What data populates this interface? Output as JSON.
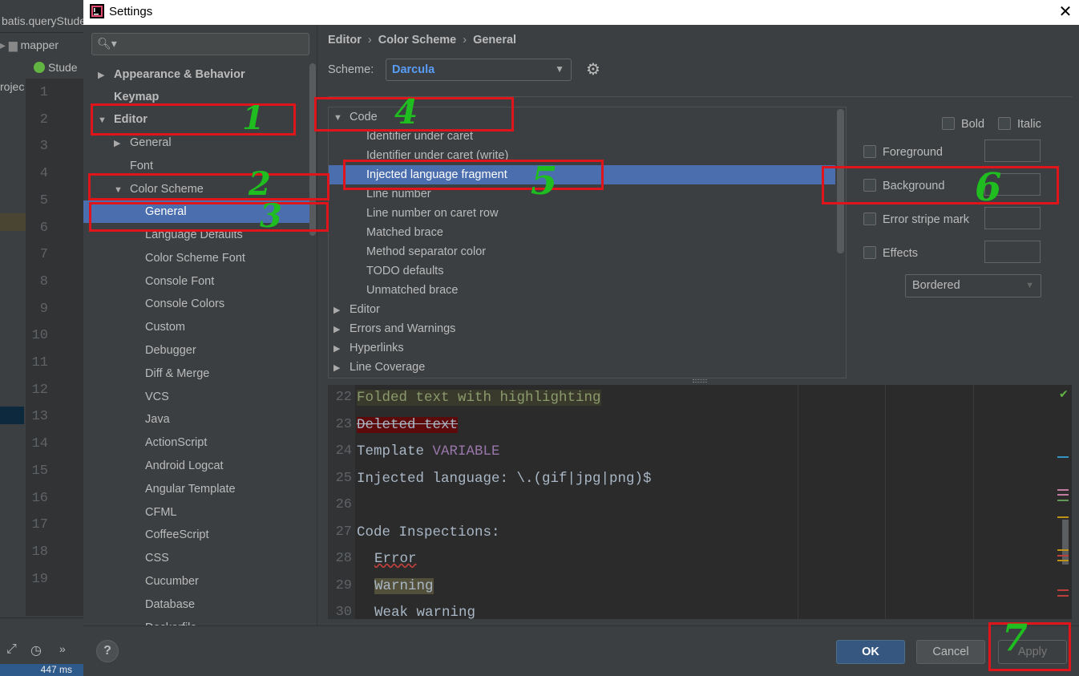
{
  "ide": {
    "tab_text": "batis.queryStude",
    "crumb_text": "mapper",
    "filetab_text": "Stude",
    "project_label": "rojec",
    "gutter_numbers": [
      "1",
      "2",
      "3",
      "4",
      "5",
      "6",
      "7",
      "8",
      "9",
      "10",
      "11",
      "12",
      "13",
      "14",
      "15",
      "16",
      "17",
      "18",
      "19"
    ],
    "perf_text": "447 ms"
  },
  "dialog": {
    "title": "Settings",
    "close_label": "✕"
  },
  "nav": {
    "search_placeholder": "",
    "items": [
      {
        "label": "Appearance & Behavior"
      },
      {
        "label": "Keymap"
      },
      {
        "label": "Editor"
      },
      {
        "label": "General"
      },
      {
        "label": "Font"
      },
      {
        "label": "Color Scheme"
      },
      {
        "label": "General"
      },
      {
        "label": "Language Defaults"
      },
      {
        "label": "Color Scheme Font"
      },
      {
        "label": "Console Font"
      },
      {
        "label": "Console Colors"
      },
      {
        "label": "Custom"
      },
      {
        "label": "Debugger"
      },
      {
        "label": "Diff & Merge"
      },
      {
        "label": "VCS"
      },
      {
        "label": "Java"
      },
      {
        "label": "ActionScript"
      },
      {
        "label": "Android Logcat"
      },
      {
        "label": "Angular Template"
      },
      {
        "label": "CFML"
      },
      {
        "label": "CoffeeScript"
      },
      {
        "label": "CSS"
      },
      {
        "label": "Cucumber"
      },
      {
        "label": "Database"
      },
      {
        "label": "Dockerfile"
      }
    ]
  },
  "header": {
    "breadcrumb": [
      "Editor",
      "Color Scheme",
      "General"
    ],
    "scheme_label": "Scheme:",
    "scheme_value": "Darcula"
  },
  "tree": {
    "rows": [
      {
        "label": "Code"
      },
      {
        "label": "Identifier under caret"
      },
      {
        "label": "Identifier under caret (write)"
      },
      {
        "label": "Injected language fragment"
      },
      {
        "label": "Line number"
      },
      {
        "label": "Line number on caret row"
      },
      {
        "label": "Matched brace"
      },
      {
        "label": "Method separator color"
      },
      {
        "label": "TODO defaults"
      },
      {
        "label": "Unmatched brace"
      },
      {
        "label": "Editor"
      },
      {
        "label": "Errors and Warnings"
      },
      {
        "label": "Hyperlinks"
      },
      {
        "label": "Line Coverage"
      }
    ]
  },
  "attributes": {
    "bold": "Bold",
    "italic": "Italic",
    "foreground": "Foreground",
    "background": "Background",
    "error_stripe": "Error stripe mark",
    "effects": "Effects",
    "effects_type": "Bordered"
  },
  "preview": {
    "lines": [
      {
        "num": "22",
        "text": "Folded text with highlighting"
      },
      {
        "num": "23",
        "text": "Deleted text"
      },
      {
        "num": "24",
        "text": "Template ",
        "extra": "VARIABLE"
      },
      {
        "num": "25",
        "text": "Injected language: \\.(gif|jpg|png)$"
      },
      {
        "num": "26",
        "text": ""
      },
      {
        "num": "27",
        "text": "Code Inspections:"
      },
      {
        "num": "28",
        "text": "Error"
      },
      {
        "num": "29",
        "text": "Warning"
      },
      {
        "num": "30",
        "text": "Weak warning"
      }
    ]
  },
  "footer": {
    "help": "?",
    "ok": "OK",
    "cancel": "Cancel",
    "apply": "Apply"
  },
  "annotations": [
    "1",
    "2",
    "3",
    "4",
    "5",
    "6",
    "7"
  ],
  "colors": {
    "selection": "#4b6eaf",
    "annotation_box": "#e0151b",
    "annotation_digit": "#1fbd1f",
    "scheme_name": "#589df6"
  }
}
